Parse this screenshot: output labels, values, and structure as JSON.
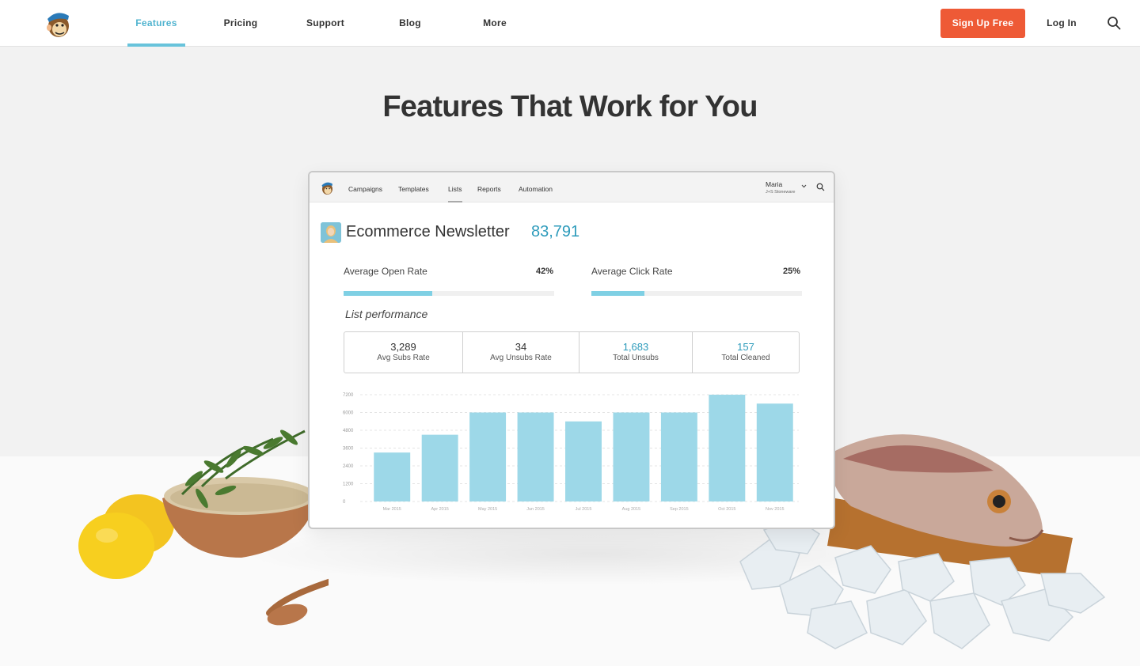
{
  "nav": {
    "items": [
      {
        "label": "Features",
        "active": true
      },
      {
        "label": "Pricing",
        "active": false
      },
      {
        "label": "Support",
        "active": false
      },
      {
        "label": "Blog",
        "active": false
      },
      {
        "label": "More",
        "active": false
      }
    ],
    "signup_label": "Sign Up Free",
    "login_label": "Log In",
    "accent_color": "#68c3db",
    "signup_color": "#ee5a36"
  },
  "hero": {
    "title": "Features That Work for You"
  },
  "app": {
    "nav": [
      "Campaigns",
      "Templates",
      "Lists",
      "Reports",
      "Automation"
    ],
    "active_tab": "Lists",
    "user": {
      "name": "Maria",
      "org": "J+S Stoneware"
    },
    "list": {
      "title": "Ecommerce Newsletter",
      "count": "83,791"
    },
    "rates": [
      {
        "label": "Average Open Rate",
        "value": "42%",
        "fraction": 0.42
      },
      {
        "label": "Average Click Rate",
        "value": "25%",
        "fraction": 0.25
      }
    ],
    "performance_title": "List performance",
    "stats": [
      {
        "value": "3,289",
        "label": "Avg Subs Rate",
        "highlight": false
      },
      {
        "value": "34",
        "label": "Avg Unsubs Rate",
        "highlight": false
      },
      {
        "value": "1,683",
        "label": "Total Unsubs",
        "highlight": true
      },
      {
        "value": "157",
        "label": "Total Cleaned",
        "highlight": true
      }
    ]
  },
  "chart_data": {
    "type": "bar",
    "categories": [
      "Mar 2015",
      "Apr 2015",
      "May 2015",
      "Jun 2015",
      "Jul 2015",
      "Aug 2015",
      "Sep 2015",
      "Oct 2015",
      "Nov 2015"
    ],
    "values": [
      3300,
      4500,
      6000,
      6000,
      5400,
      6000,
      6000,
      7200,
      6600
    ],
    "ylim": [
      0,
      7200
    ],
    "yticks": [
      0,
      1200,
      2400,
      3600,
      4800,
      6000,
      7200
    ],
    "grid": true,
    "bar_color": "#9dd8e8",
    "title": "",
    "xlabel": "",
    "ylabel": ""
  }
}
